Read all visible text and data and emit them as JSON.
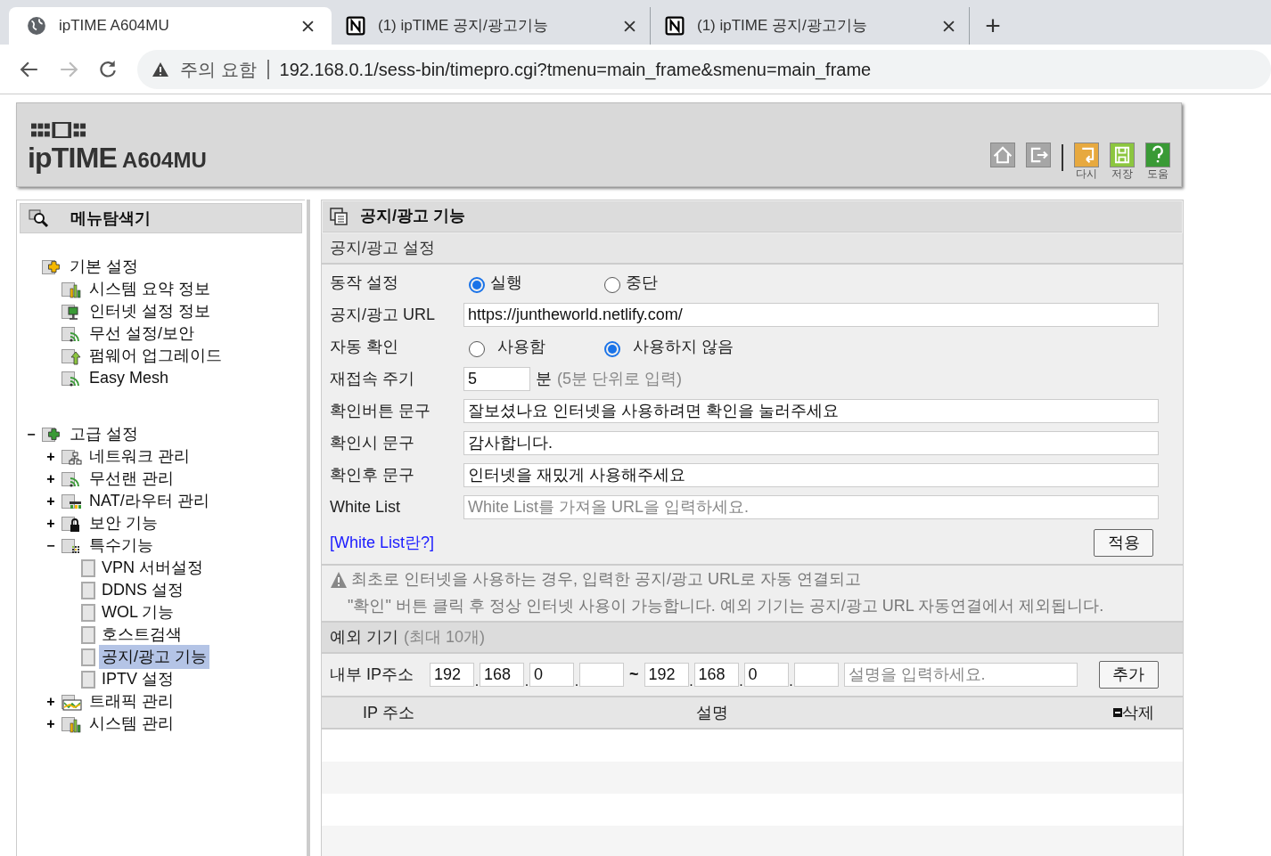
{
  "browser": {
    "tabs": [
      {
        "title": "ipTIME A604MU",
        "kind": "globe",
        "selected": true
      },
      {
        "title": "(1) ipTIME 공지/광고기능",
        "kind": "notion",
        "selected": false
      },
      {
        "title": "(1) ipTIME 공지/광고기능",
        "kind": "notion",
        "selected": false
      }
    ],
    "new_tab": "+",
    "security": "주의 요함",
    "url": "192.168.0.1/sess-bin/timepro.cgi?tmenu=main_frame&smenu=main_frame"
  },
  "header": {
    "logo": "ipTIME",
    "model": "A604MU",
    "tools": [
      {
        "kind": "home"
      },
      {
        "kind": "logout"
      },
      {
        "kind": "reload",
        "label": "다시"
      },
      {
        "kind": "save",
        "label": "저장"
      },
      {
        "kind": "help",
        "label": "도움"
      }
    ]
  },
  "sidebar": {
    "title": "메뉴탐색기",
    "items": [
      {
        "label": "기본 설정",
        "kind": "folder-plus-yellow",
        "selected": false,
        "children": [
          {
            "label": "시스템 요약 정보",
            "kind": "chart",
            "selected": false
          },
          {
            "label": "인터넷 설정 정보",
            "kind": "monitor",
            "selected": false
          },
          {
            "label": "무선 설정/보안",
            "kind": "wifi",
            "selected": false
          },
          {
            "label": "펌웨어 업그레이드",
            "kind": "upgrade",
            "selected": false
          },
          {
            "label": "Easy Mesh",
            "kind": "wifi",
            "selected": false
          }
        ]
      },
      {
        "label": "고급 설정",
        "kind": "folder-plus-green",
        "toggle": "−",
        "expanded": true,
        "selected": false,
        "children": [
          {
            "label": "네트워크 관리",
            "kind": "network",
            "toggle": "+",
            "expanded": false,
            "selected": false
          },
          {
            "label": "무선랜 관리",
            "kind": "wifi",
            "toggle": "+",
            "expanded": false,
            "selected": false
          },
          {
            "label": "NAT/라우터 관리",
            "kind": "router",
            "toggle": "+",
            "expanded": false,
            "selected": false
          },
          {
            "label": "보안 기능",
            "kind": "lock",
            "toggle": "+",
            "expanded": false,
            "selected": false
          },
          {
            "label": "특수기능",
            "kind": "dots",
            "toggle": "−",
            "expanded": true,
            "selected": false,
            "children": [
              {
                "label": "VPN 서버설정",
                "kind": "page",
                "selected": false
              },
              {
                "label": "DDNS 설정",
                "kind": "page",
                "selected": false
              },
              {
                "label": "WOL 기능",
                "kind": "page",
                "selected": false
              },
              {
                "label": "호스트검색",
                "kind": "page",
                "selected": false
              },
              {
                "label": "공지/광고 기능",
                "kind": "page",
                "selected": true
              },
              {
                "label": "IPTV 설정",
                "kind": "page",
                "selected": false
              }
            ]
          },
          {
            "label": "트래픽 관리",
            "kind": "traffic",
            "toggle": "+",
            "expanded": false,
            "selected": false
          },
          {
            "label": "시스템 관리",
            "kind": "chart",
            "toggle": "+",
            "expanded": false,
            "selected": false
          }
        ]
      }
    ]
  },
  "main": {
    "title": "공지/광고 기능",
    "section": "공지/광고 설정",
    "rows": [
      {
        "kind": "radio",
        "label": "동작 설정",
        "options": [
          {
            "label": "실행",
            "selected": true
          },
          {
            "label": "중단",
            "selected": false
          }
        ]
      },
      {
        "kind": "text",
        "label": "공지/광고 URL",
        "value": "https://juntheworld.netlify.com/"
      },
      {
        "kind": "radio",
        "label": "자동 확인",
        "options": [
          {
            "label": "사용함",
            "selected": false
          },
          {
            "label": "사용하지 않음",
            "selected": true
          }
        ]
      },
      {
        "kind": "number",
        "label": "재접속 주기",
        "value": "5",
        "unit": "분",
        "hint": "(5분 단위로 입력)"
      },
      {
        "kind": "text",
        "label": "확인버튼 문구",
        "value": "잘보셨나요 인터넷을 사용하려면 확인을 눌러주세요"
      },
      {
        "kind": "text",
        "label": "확인시 문구",
        "value": "감사합니다."
      },
      {
        "kind": "text",
        "label": "확인후 문구",
        "value": "인터넷을 재밌게 사용해주세요"
      },
      {
        "kind": "text",
        "label": "White List",
        "placeholder": "White List를 가져올 URL을 입력하세요."
      }
    ],
    "link": "[White List란?]",
    "apply": "적용",
    "notice": [
      "최초로 인터넷을 사용하는 경우, 입력한 공지/광고 URL로 자동 연결되고",
      "\"확인\" 버튼 클릭 후 정상 인터넷 사용이 가능합니다. 예외 기기는 공지/광고 URL 자동연결에서 제외됩니다."
    ],
    "exceptions": {
      "title": "예외 기기",
      "hint": "(최대 10개)",
      "label": "내부 IP주소",
      "octet_separator": ".",
      "from": [
        "192",
        "168",
        "0"
      ],
      "separator": "~",
      "to": [
        "192",
        "168",
        "0"
      ],
      "description_placeholder": "설명을 입력하세요.",
      "add": "추가",
      "columns": [
        "IP 주소",
        "설명",
        "삭제"
      ]
    }
  }
}
